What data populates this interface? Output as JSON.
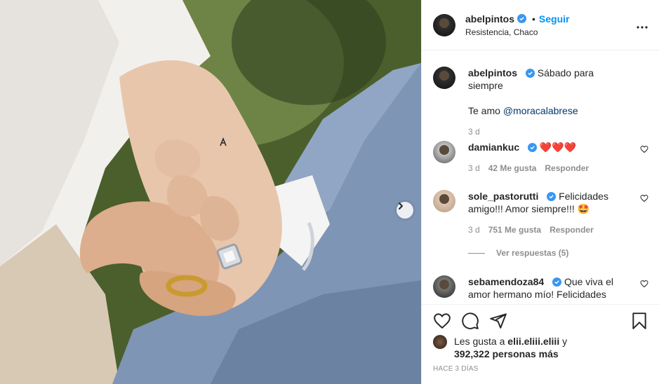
{
  "post": {
    "author": "abelpintos",
    "follow_label": "Seguir",
    "dot": "•",
    "location": "Resistencia, Chaco",
    "more_label": "•••"
  },
  "caption": {
    "author": "abelpintos",
    "line1": "Sábado para siempre",
    "line2_prefix": "Te amo",
    "mention": "@moracalabrese",
    "time": "3 d"
  },
  "comments": [
    {
      "user": "damiankuc",
      "text": "❤️❤️❤️",
      "time": "3 d",
      "likes": "42 Me gusta",
      "reply": "Responder"
    },
    {
      "user": "sole_pastorutti",
      "text": "Felicidades amigo!!! Amor siempre!!! 🤩",
      "time": "3 d",
      "likes": "751 Me gusta",
      "reply": "Responder"
    },
    {
      "user": "sebamendoza84",
      "text": "Que viva el amor hermano mío! Felicidades"
    }
  ],
  "view_replies": "Ver respuestas (5)",
  "likes": {
    "prefix": "Les gusta a",
    "user": "elii.eliii.eliii",
    "mid": "y",
    "count": "392,322 personas más"
  },
  "posted_ago": "HACE 3 DÍAS",
  "icons": {
    "like": "heart-icon",
    "comment": "comment-icon",
    "share": "paper-plane-icon",
    "save": "bookmark-icon",
    "next": "chevron-right-icon",
    "more": "more-options-icon",
    "verified": "verified-badge-icon"
  }
}
